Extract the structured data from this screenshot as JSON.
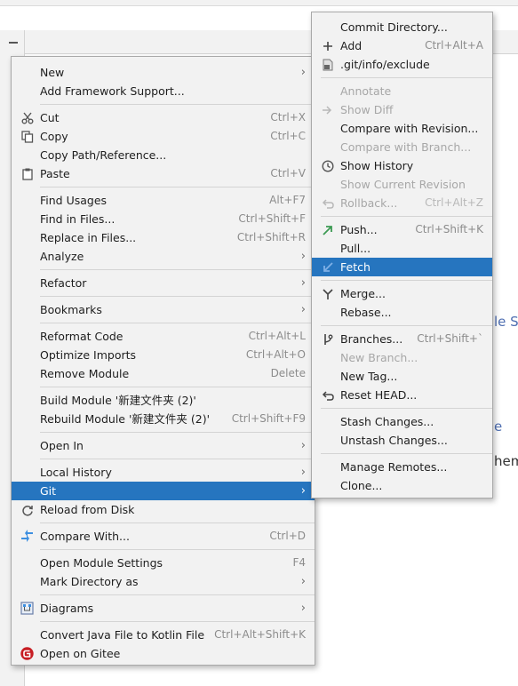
{
  "background": {
    "fragments": [
      "le S",
      "e",
      "hem"
    ],
    "fragment_color": "#4f6fb2"
  },
  "context_menu": {
    "items": [
      {
        "label": "New",
        "submenu": true
      },
      {
        "label": "Add Framework Support..."
      },
      {
        "type": "separator"
      },
      {
        "label": "Cut",
        "shortcut": "Ctrl+X",
        "icon": "scissors-icon"
      },
      {
        "label": "Copy",
        "shortcut": "Ctrl+C",
        "icon": "copy-icon"
      },
      {
        "label": "Copy Path/Reference..."
      },
      {
        "label": "Paste",
        "shortcut": "Ctrl+V",
        "icon": "clipboard-icon"
      },
      {
        "type": "separator"
      },
      {
        "label": "Find Usages",
        "shortcut": "Alt+F7"
      },
      {
        "label": "Find in Files...",
        "shortcut": "Ctrl+Shift+F"
      },
      {
        "label": "Replace in Files...",
        "shortcut": "Ctrl+Shift+R"
      },
      {
        "label": "Analyze",
        "submenu": true
      },
      {
        "type": "separator"
      },
      {
        "label": "Refactor",
        "submenu": true
      },
      {
        "type": "separator"
      },
      {
        "label": "Bookmarks",
        "submenu": true
      },
      {
        "type": "separator"
      },
      {
        "label": "Reformat Code",
        "shortcut": "Ctrl+Alt+L"
      },
      {
        "label": "Optimize Imports",
        "shortcut": "Ctrl+Alt+O"
      },
      {
        "label": "Remove Module",
        "shortcut": "Delete"
      },
      {
        "type": "separator"
      },
      {
        "label": "Build Module '新建文件夹 (2)'"
      },
      {
        "label": "Rebuild Module '新建文件夹 (2)'",
        "shortcut": "Ctrl+Shift+F9"
      },
      {
        "type": "separator"
      },
      {
        "label": "Open In",
        "submenu": true
      },
      {
        "type": "separator"
      },
      {
        "label": "Local History",
        "submenu": true
      },
      {
        "label": "Git",
        "submenu": true,
        "selected": true
      },
      {
        "label": "Reload from Disk",
        "icon": "reload-icon"
      },
      {
        "type": "separator"
      },
      {
        "label": "Compare With...",
        "shortcut": "Ctrl+D",
        "icon": "compare-icon"
      },
      {
        "type": "separator"
      },
      {
        "label": "Open Module Settings",
        "shortcut": "F4"
      },
      {
        "label": "Mark Directory as",
        "submenu": true
      },
      {
        "type": "separator"
      },
      {
        "label": "Diagrams",
        "submenu": true,
        "icon": "diagram-icon"
      },
      {
        "type": "separator"
      },
      {
        "label": "Convert Java File to Kotlin File",
        "shortcut": "Ctrl+Alt+Shift+K"
      },
      {
        "label": "Open on Gitee",
        "icon": "gitee-icon"
      }
    ]
  },
  "git_submenu": {
    "items": [
      {
        "label": "Commit Directory..."
      },
      {
        "label": "Add",
        "shortcut": "Ctrl+Alt+A",
        "icon": "plus-icon"
      },
      {
        "label": ".git/info/exclude",
        "icon": "git-file-icon"
      },
      {
        "type": "separator"
      },
      {
        "label": "Annotate",
        "disabled": true
      },
      {
        "label": "Show Diff",
        "disabled": true,
        "icon": "diff-arrow-icon"
      },
      {
        "label": "Compare with Revision..."
      },
      {
        "label": "Compare with Branch...",
        "disabled": true
      },
      {
        "label": "Show History",
        "icon": "history-clock-icon"
      },
      {
        "label": "Show Current Revision",
        "disabled": true
      },
      {
        "label": "Rollback...",
        "shortcut": "Ctrl+Alt+Z",
        "disabled": true,
        "icon": "rollback-icon"
      },
      {
        "type": "separator"
      },
      {
        "label": "Push...",
        "shortcut": "Ctrl+Shift+K",
        "icon": "push-arrow-icon"
      },
      {
        "label": "Pull..."
      },
      {
        "label": "Fetch",
        "selected": true,
        "icon": "fetch-arrow-icon"
      },
      {
        "type": "separator"
      },
      {
        "label": "Merge...",
        "icon": "merge-icon"
      },
      {
        "label": "Rebase..."
      },
      {
        "type": "separator"
      },
      {
        "label": "Branches...",
        "shortcut": "Ctrl+Shift+`",
        "icon": "branch-icon"
      },
      {
        "label": "New Branch...",
        "disabled": true
      },
      {
        "label": "New Tag..."
      },
      {
        "label": "Reset HEAD...",
        "icon": "reset-icon"
      },
      {
        "type": "separator"
      },
      {
        "label": "Stash Changes..."
      },
      {
        "label": "Unstash Changes..."
      },
      {
        "type": "separator"
      },
      {
        "label": "Manage Remotes..."
      },
      {
        "label": "Clone..."
      }
    ]
  },
  "colors": {
    "selection": "#2675bf",
    "menu_bg": "#f2f2f2",
    "shortcut_text": "#8c8c8c",
    "disabled_text": "#a7a7a7",
    "gitee_red": "#c71d23",
    "push_green": "#3c9a53",
    "compare_blue": "#3d8fe0"
  }
}
